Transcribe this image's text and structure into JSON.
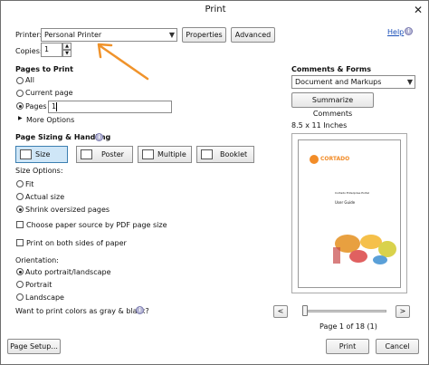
{
  "window": {
    "title": "Print",
    "close_glyph": "✕"
  },
  "printer": {
    "label": "Printer:",
    "value": "Personal Printer",
    "properties_label": "Properties",
    "advanced_label": "Advanced",
    "help_label": "Help",
    "copies_label": "Copies:",
    "copies_value": "1"
  },
  "pages_to_print": {
    "heading": "Pages to Print",
    "all_label": "All",
    "current_label": "Current page",
    "pages_label": "Pages",
    "pages_value": "1",
    "more_options_label": "More Options"
  },
  "sizing": {
    "heading": "Page Sizing & Handling",
    "buttons": [
      "Size",
      "Poster",
      "Multiple",
      "Booklet"
    ],
    "size_options_label": "Size Options:",
    "fit_label": "Fit",
    "actual_label": "Actual size",
    "shrink_label": "Shrink oversized pages",
    "paper_source_label": "Choose paper source by PDF page size",
    "both_sides_label": "Print on both sides of paper"
  },
  "orientation": {
    "heading": "Orientation:",
    "auto_label": "Auto portrait/landscape",
    "portrait_label": "Portrait",
    "landscape_label": "Landscape"
  },
  "gray_label": "Want to print colors as gray & black?",
  "comments": {
    "heading": "Comments & Forms",
    "value": "Document and Markups",
    "summarize_label": "Summarize Comments"
  },
  "preview": {
    "paper_size": "8.5 x 11 Inches",
    "logo_text": "CORTADO",
    "doc_title": "Cortado Enterprise Portal",
    "doc_subtitle": "User Guide",
    "page_indicator": "Page 1 of 18 (1)"
  },
  "footer": {
    "page_setup_label": "Page Setup...",
    "print_label": "Print",
    "cancel_label": "Cancel"
  },
  "colors": {
    "annotation_arrow": "#f0932b",
    "active_button": "#cfe6f7",
    "logo_orange": "#f28c28"
  }
}
